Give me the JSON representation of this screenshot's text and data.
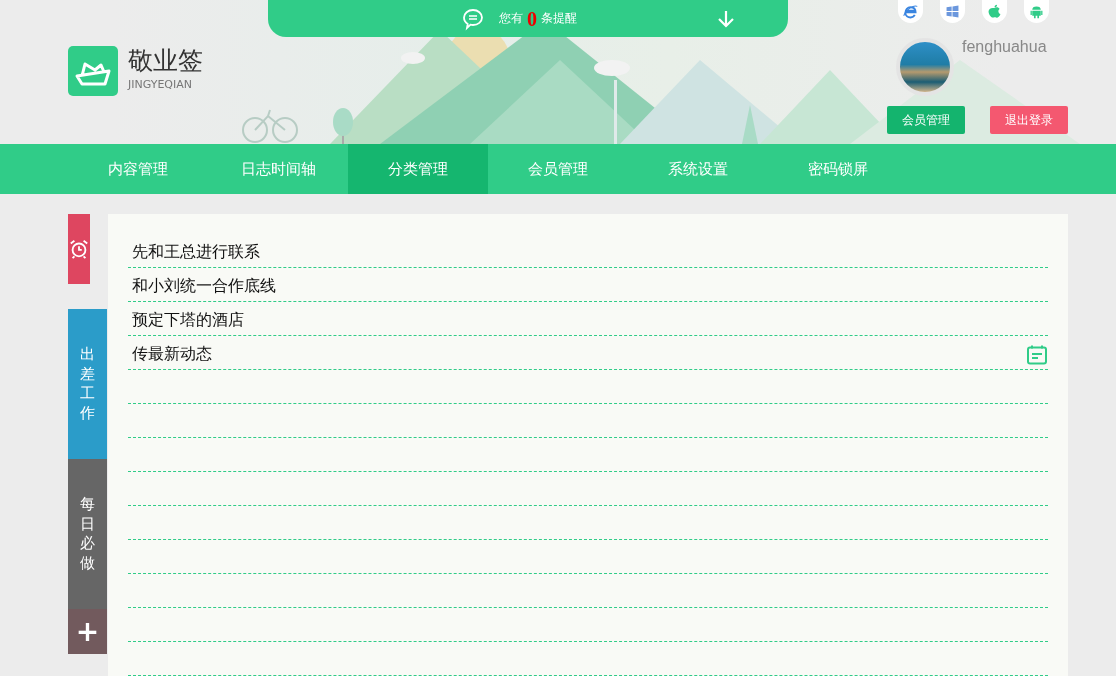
{
  "notice": {
    "prefix": "您有",
    "count": "0",
    "suffix": "条提醒"
  },
  "logo": {
    "name": "敬业签",
    "pinyin": "JINGYEQIAN"
  },
  "platforms": [
    {
      "kind": "ie"
    },
    {
      "kind": "windows"
    },
    {
      "kind": "apple"
    },
    {
      "kind": "android"
    }
  ],
  "user": {
    "name": "fenghuahua",
    "buttons": [
      {
        "label": "会员管理",
        "kind": "primary"
      },
      {
        "label": "退出登录",
        "kind": "danger"
      }
    ]
  },
  "nav": [
    {
      "label": "内容管理",
      "selected": false
    },
    {
      "label": "日志时间轴",
      "selected": false
    },
    {
      "label": "分类管理",
      "selected": true
    },
    {
      "label": "会员管理",
      "selected": false
    },
    {
      "label": "系统设置",
      "selected": false
    },
    {
      "label": "密码锁屏",
      "selected": false
    }
  ],
  "side_tabs": [
    {
      "kind": "alarm",
      "color": "#de4660"
    },
    {
      "kind": "category",
      "label": "出差工作",
      "color": "#2b9cc9"
    },
    {
      "kind": "category",
      "label": "每日必做",
      "color": "#666666"
    },
    {
      "kind": "add",
      "label": "+",
      "color": "#725a5d"
    }
  ],
  "tasks": [
    {
      "text": "先和王总进行联系",
      "reminder": false
    },
    {
      "text": "和小刘统一合作底线",
      "reminder": false
    },
    {
      "text": "预定下塔的酒店",
      "reminder": false
    },
    {
      "text": "传最新动态",
      "reminder": true
    }
  ]
}
